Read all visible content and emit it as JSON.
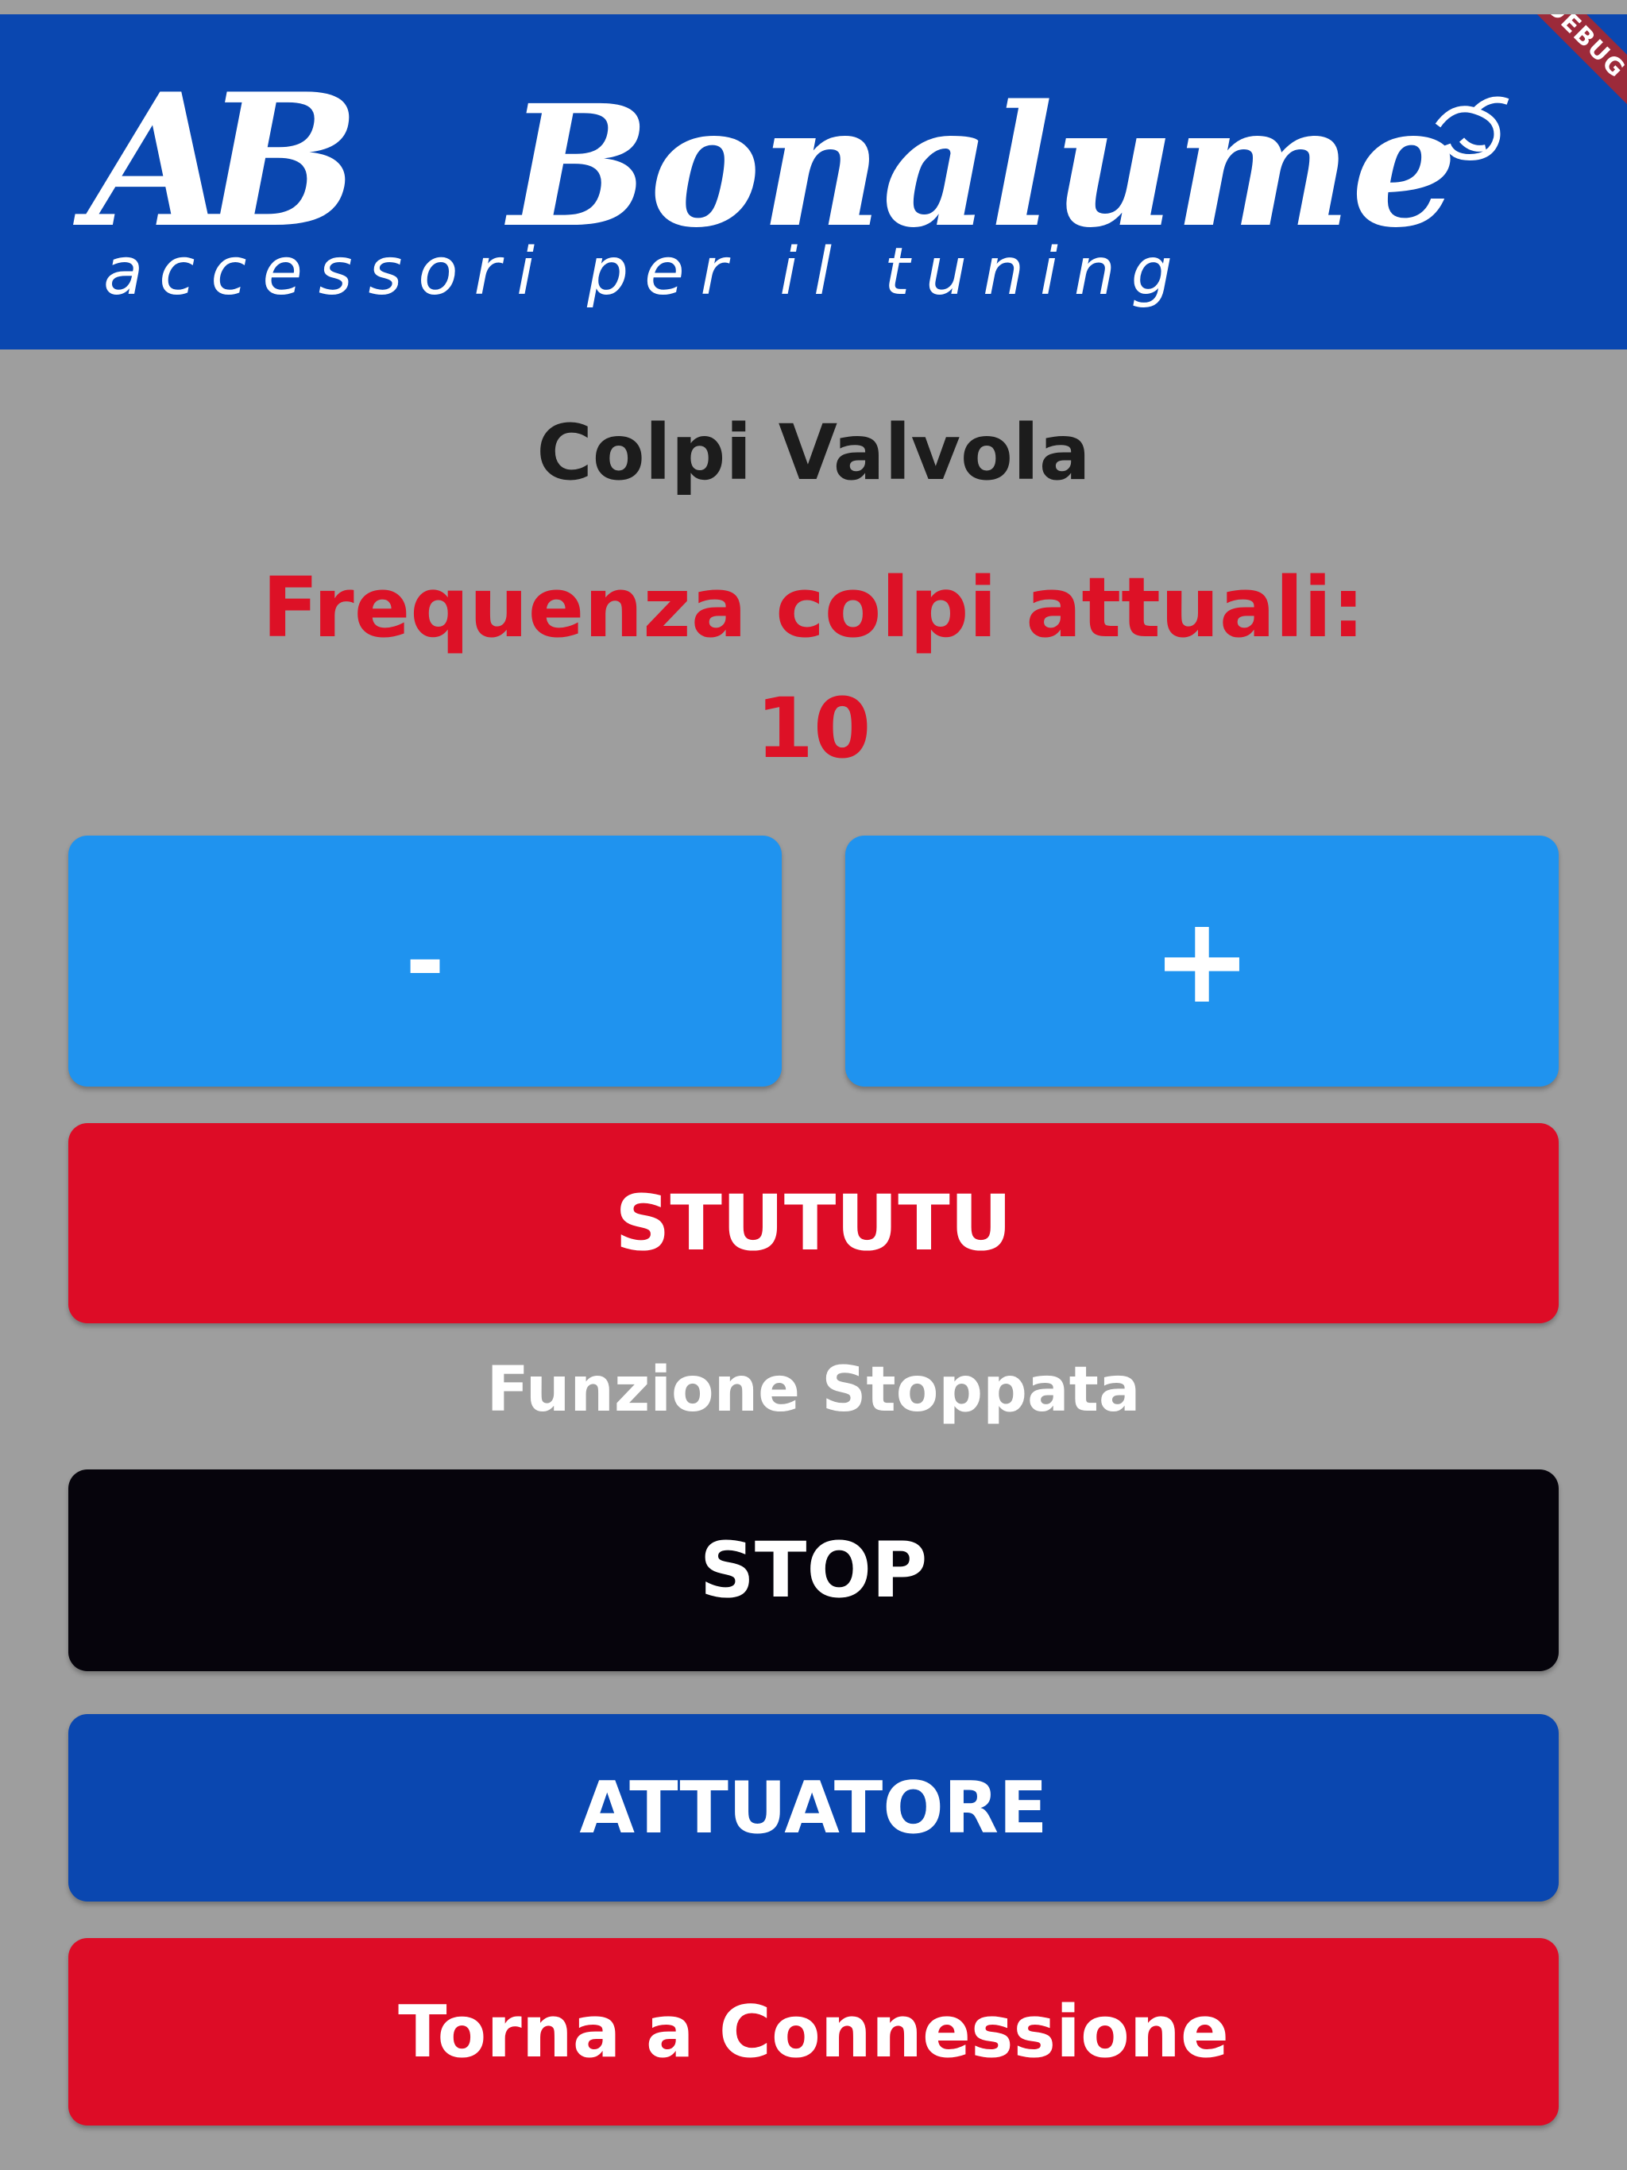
{
  "banner": {
    "brand_monogram": "AB",
    "brand_name": "Bonalume",
    "brand_tagline": "accessori per il tuning",
    "debug_label": "DEBUG"
  },
  "main": {
    "title": "Colpi Valvola",
    "frequency_label": "Frequenza colpi attuali:",
    "frequency_value": "10",
    "status_text": "Funzione Stoppata"
  },
  "buttons": {
    "decrement": "-",
    "increment": "+",
    "stututu": "STUTUTU",
    "stop": "STOP",
    "attuatore": "ATTUATORE",
    "back": "Torna a Connessione"
  },
  "colors": {
    "background": "#9e9e9e",
    "banner_blue": "#0a47b0",
    "accent_red": "#dd0c26",
    "button_light_blue": "#1f93ef",
    "stop_black": "#06040c",
    "text_dark": "#1c1c1c",
    "text_white": "#ffffff"
  }
}
